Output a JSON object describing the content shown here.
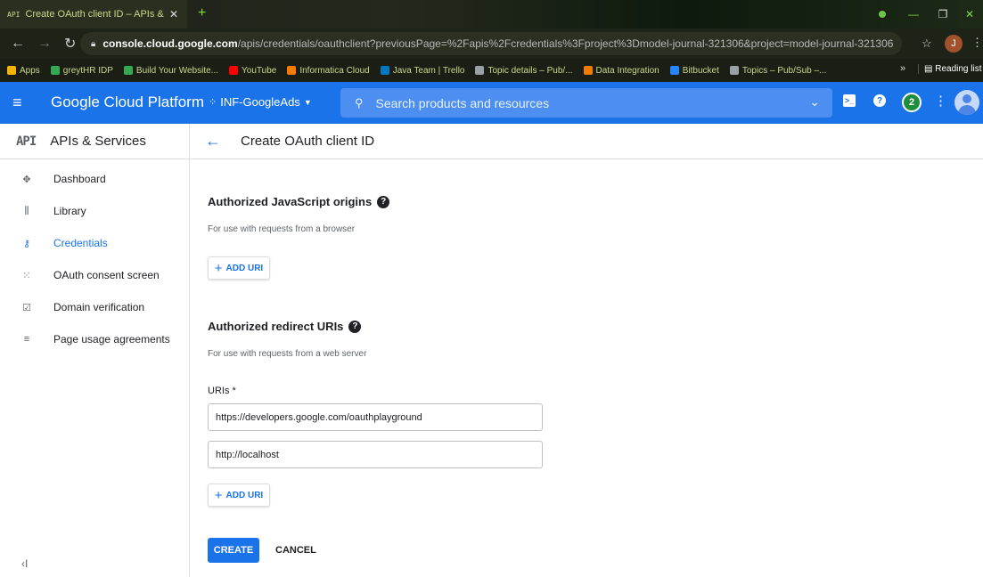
{
  "browser": {
    "tab_badge": "API",
    "tab_title": "Create OAuth client ID – APIs &",
    "tab_close": "✕",
    "new_tab": "+",
    "url_host": "console.cloud.google.com",
    "url_path": "/apis/credentials/oauthclient?previousPage=%2Fapis%2Fcredentials%3Fproject%3Dmodel-journal-321306&project=model-journal-321306",
    "profile_initial": "J",
    "bookmarks": [
      {
        "label": "Apps",
        "color": "#f4b400"
      },
      {
        "label": "greytHR IDP",
        "color": "#34a853"
      },
      {
        "label": "Build Your Website...",
        "color": "#34a853"
      },
      {
        "label": "YouTube",
        "color": "#ff0000"
      },
      {
        "label": "Informatica Cloud",
        "color": "#f57c00"
      },
      {
        "label": "Java Team | Trello",
        "color": "#0079bf"
      },
      {
        "label": "Topic details – Pub/...",
        "color": "#9aa0a6"
      },
      {
        "label": "Data Integration",
        "color": "#f57c00"
      },
      {
        "label": "Bitbucket",
        "color": "#2684ff"
      },
      {
        "label": "Topics – Pub/Sub –...",
        "color": "#9aa0a6"
      }
    ],
    "more_bookmarks": "»",
    "reading_list": "Reading list"
  },
  "header": {
    "menu_icon": "≡",
    "title": "Google Cloud Platform",
    "project": "INF-GoogleAds",
    "search_placeholder": "Search products and resources",
    "notifications_count": "2"
  },
  "sidebar": {
    "api_badge": "API",
    "title": "APIs & Services",
    "items": [
      {
        "label": "Dashboard",
        "icon": "dashboard-icon",
        "glyph": "✥"
      },
      {
        "label": "Library",
        "icon": "library-icon",
        "glyph": "⫼"
      },
      {
        "label": "Credentials",
        "icon": "key-icon",
        "glyph": "⚷"
      },
      {
        "label": "OAuth consent screen",
        "icon": "consent-icon",
        "glyph": "⁙"
      },
      {
        "label": "Domain verification",
        "icon": "checkbox-icon",
        "glyph": "☑"
      },
      {
        "label": "Page usage agreements",
        "icon": "settings-list-icon",
        "glyph": "≡"
      }
    ],
    "active_index": 2,
    "collapse_glyph": "‹I"
  },
  "main": {
    "page_title": "Create OAuth client ID",
    "js_origins": {
      "title": "Authorized JavaScript origins",
      "hint": "For use with requests from a browser",
      "add_label": "ADD URI"
    },
    "redirect_uris": {
      "title": "Authorized redirect URIs",
      "hint": "For use with requests from a web server",
      "uris_label": "URIs *",
      "uris": [
        "https://developers.google.com/oauthplayground",
        "http://localhost"
      ],
      "add_label": "ADD URI"
    },
    "create_label": "CREATE",
    "cancel_label": "CANCEL"
  },
  "colors": {
    "accent": "#1a73e8",
    "header": "#1a73e8"
  }
}
